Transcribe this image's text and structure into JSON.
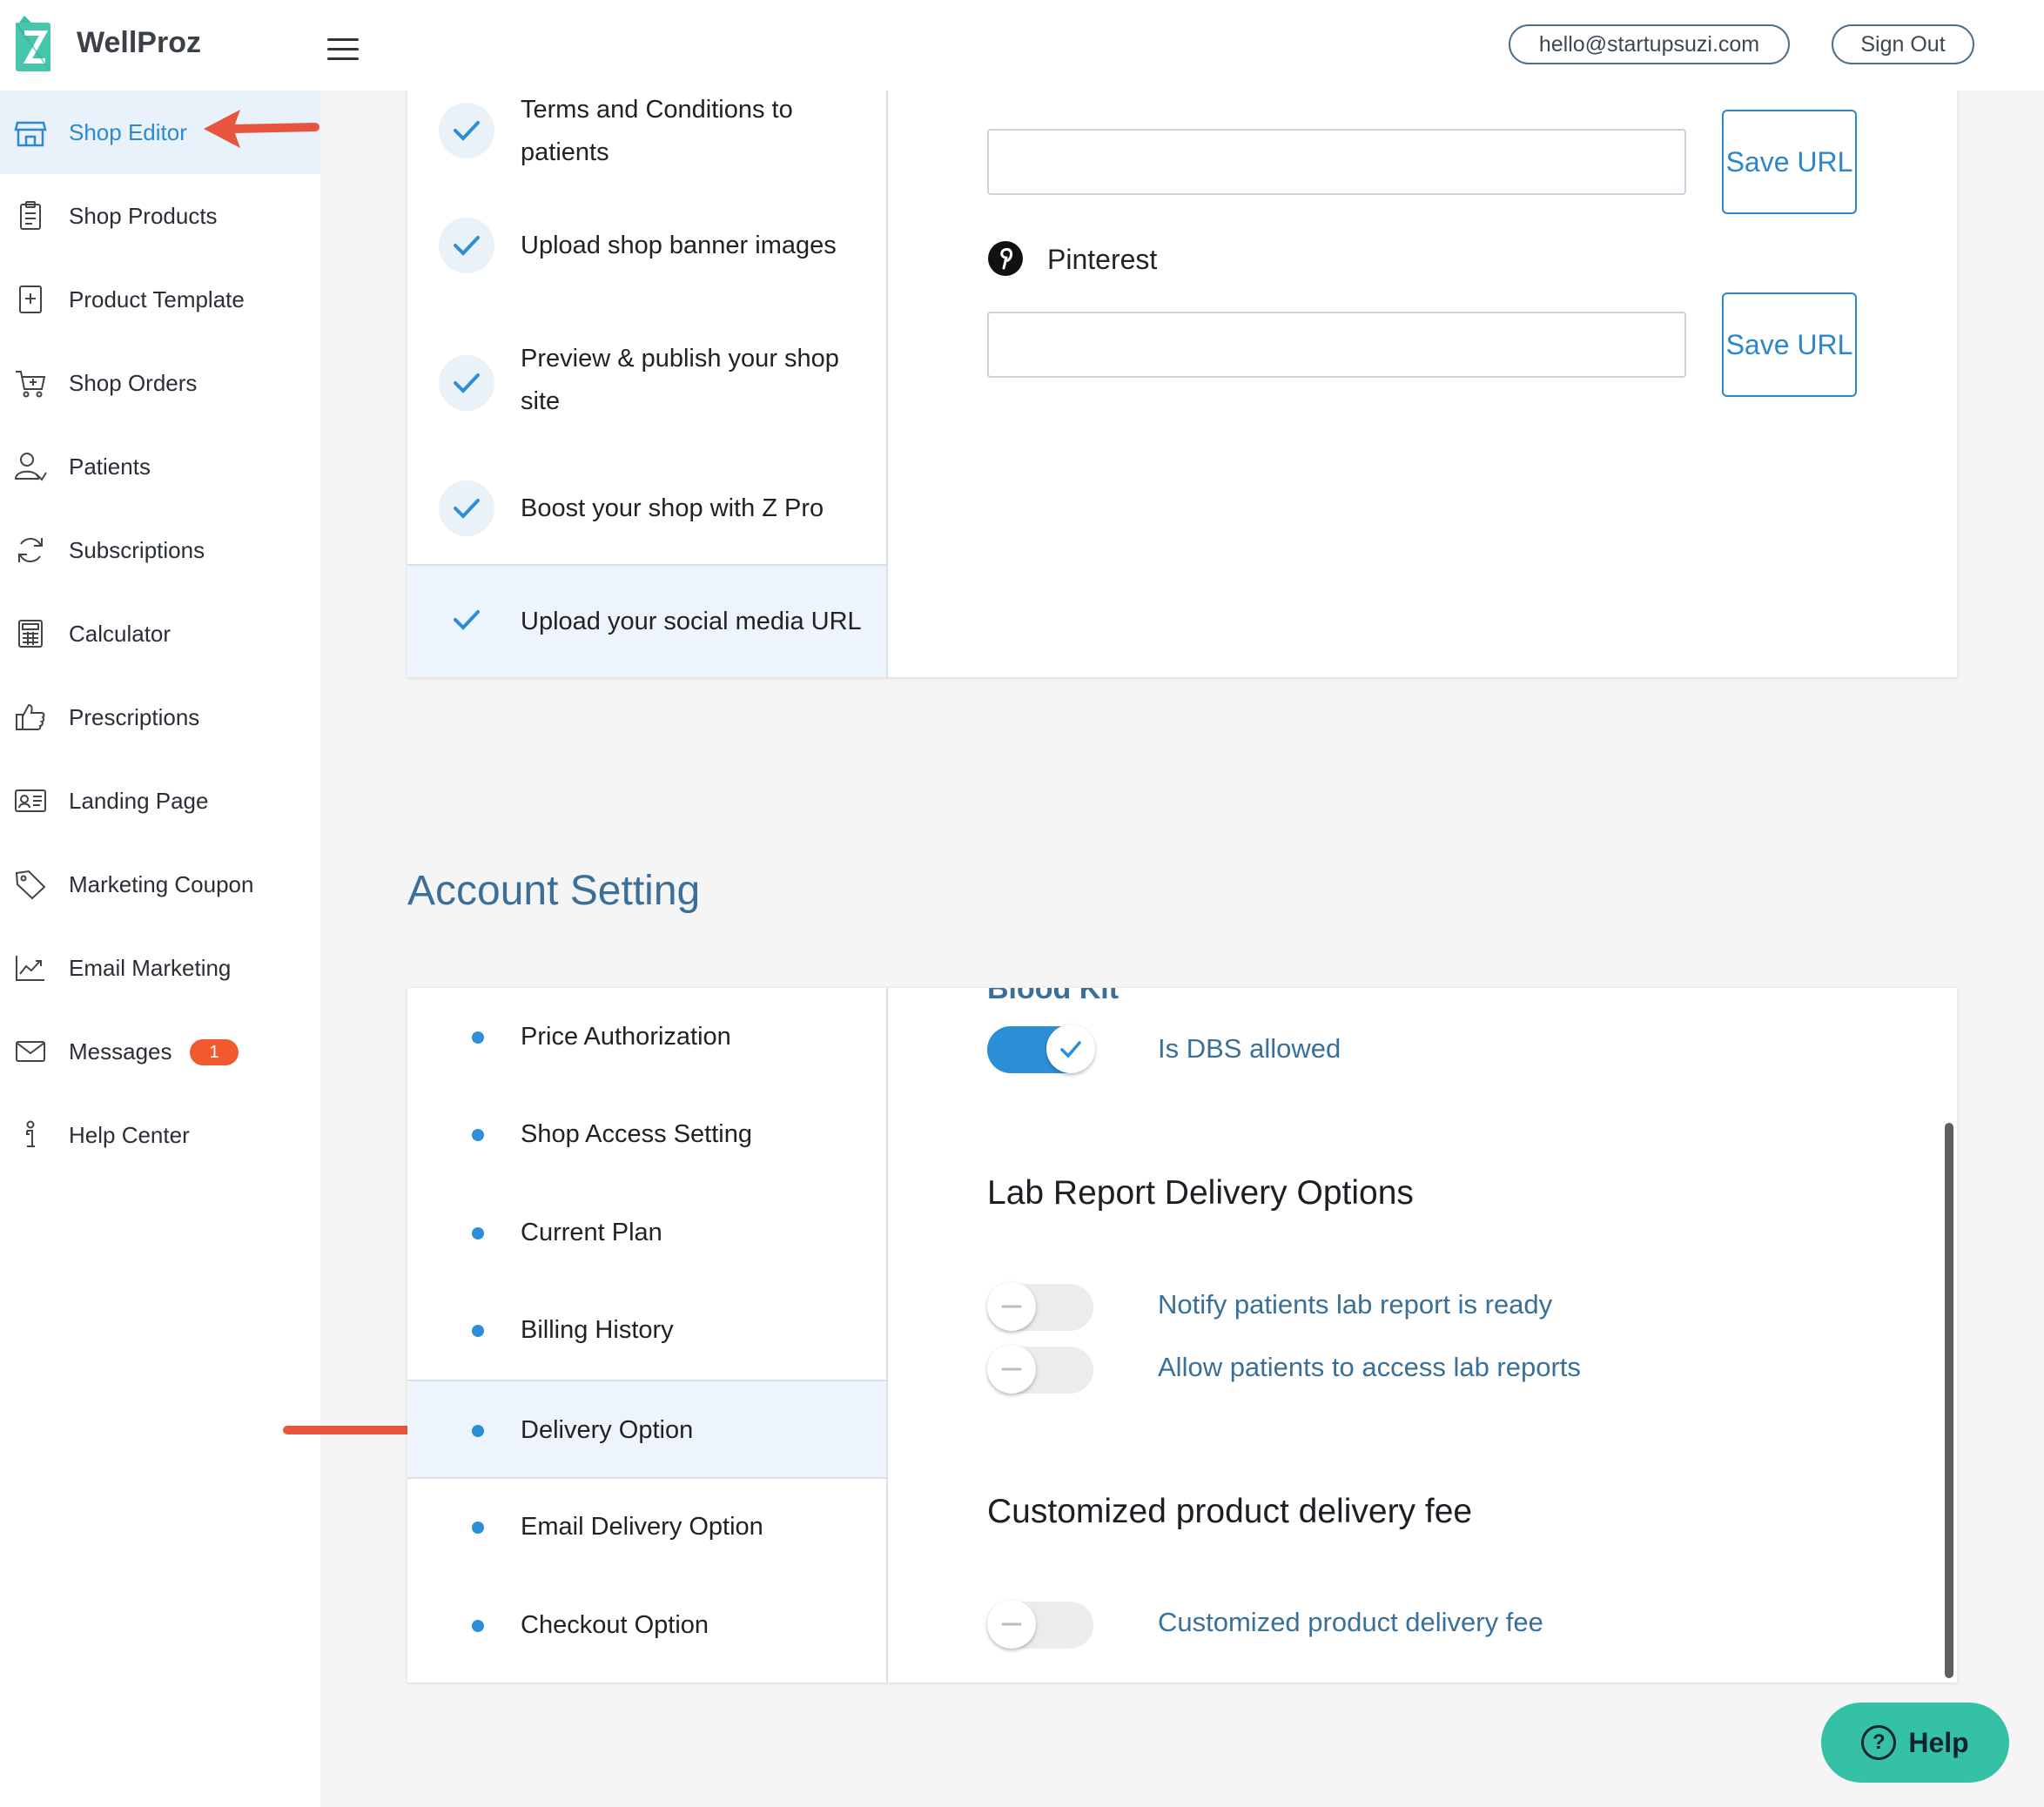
{
  "header": {
    "brand": "WellProz",
    "email": "hello@startupsuzi.com",
    "sign_out": "Sign Out"
  },
  "sidebar": {
    "items": [
      {
        "label": "Shop Editor",
        "icon": "store-icon",
        "active": true
      },
      {
        "label": "Shop Products",
        "icon": "clipboard-icon"
      },
      {
        "label": "Product Template",
        "icon": "add-document-icon"
      },
      {
        "label": "Shop Orders",
        "icon": "cart-icon"
      },
      {
        "label": "Patients",
        "icon": "patient-icon"
      },
      {
        "label": "Subscriptions",
        "icon": "refresh-icon"
      },
      {
        "label": "Calculator",
        "icon": "calculator-icon"
      },
      {
        "label": "Prescriptions",
        "icon": "thumbs-up-icon"
      },
      {
        "label": "Landing Page",
        "icon": "id-card-icon"
      },
      {
        "label": "Marketing Coupon",
        "icon": "tag-icon"
      },
      {
        "label": "Email Marketing",
        "icon": "trend-chart-icon"
      },
      {
        "label": "Messages",
        "icon": "mail-icon",
        "badge": "1"
      },
      {
        "label": "Help Center",
        "icon": "help-figure-icon"
      }
    ]
  },
  "setup_steps": [
    {
      "label": "Terms and Conditions to patients"
    },
    {
      "label": "Upload shop banner images"
    },
    {
      "label": "Preview & publish your shop site"
    },
    {
      "label": "Boost your shop with Z Pro"
    },
    {
      "label": "Upload your social media URL",
      "active": true
    }
  ],
  "social": {
    "save_label": "Save URL",
    "pinterest_label": "Pinterest",
    "first_url_value": "",
    "pinterest_url_value": ""
  },
  "account_setting": {
    "title": "Account Setting",
    "menu": [
      {
        "label": "Price Authorization"
      },
      {
        "label": "Shop Access Setting"
      },
      {
        "label": "Current Plan"
      },
      {
        "label": "Billing History"
      },
      {
        "label": "Delivery Option",
        "active": true
      },
      {
        "label": "Email Delivery Option"
      },
      {
        "label": "Checkout Option"
      }
    ],
    "cut_off_text": "Blood Kit",
    "dbs_label": "Is DBS allowed",
    "dbs_on": true,
    "lab_heading": "Lab Report Delivery Options",
    "notify_label": "Notify patients lab report is ready",
    "notify_on": false,
    "access_label": "Allow patients to access lab reports",
    "access_on": false,
    "custom_heading": "Customized product delivery fee",
    "custom_label": "Customized product delivery fee",
    "custom_on": false
  },
  "help_button": "Help",
  "colors": {
    "accent": "#2c8ad0",
    "toggle_on": "#2b8fd8",
    "badge": "#f05a2e",
    "help": "#35c2a4",
    "arrow": "#e8553f"
  }
}
